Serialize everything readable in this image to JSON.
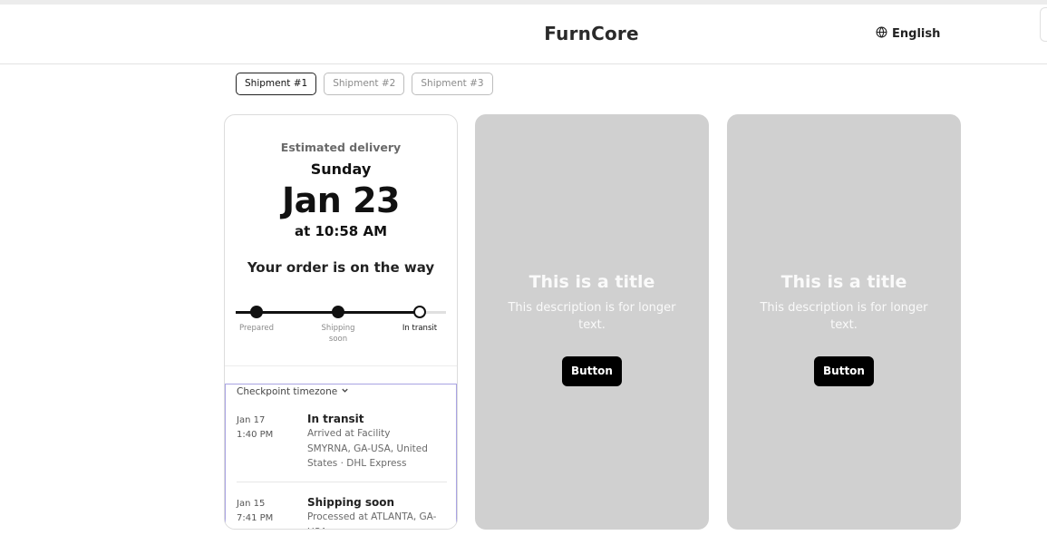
{
  "header": {
    "brand": "FurnCore",
    "language": "English",
    "globe_icon": "globe-icon"
  },
  "tabs": [
    {
      "label": "Shipment #1",
      "active": true
    },
    {
      "label": "Shipment #2",
      "active": false
    },
    {
      "label": "Shipment #3",
      "active": false
    }
  ],
  "delivery": {
    "label": "Estimated delivery",
    "day": "Sunday",
    "date": "Jan 23",
    "time": "at 10:58 AM",
    "status": "Your order is on the way"
  },
  "progress": {
    "steps": [
      {
        "label": "Prepared",
        "state": "done"
      },
      {
        "label": "Shipping soon",
        "state": "done"
      },
      {
        "label": "In transit",
        "state": "current"
      }
    ]
  },
  "checkpoints": {
    "timezone_label": "Checkpoint timezone",
    "chevron_icon": "chevron-down-icon",
    "items": [
      {
        "date": "Jan 17",
        "time": "1:40 PM",
        "title": "In transit",
        "desc": "Arrived at Facility",
        "location": "SMYRNA, GA-USA, United States · DHL Express"
      },
      {
        "date": "Jan 15",
        "time": "7:41 PM",
        "title": "Shipping soon",
        "desc": "Processed at ATLANTA, GA-USA"
      }
    ]
  },
  "placeholders": [
    {
      "title": "This is a title",
      "desc": "This description is for longer text.",
      "button": "Button"
    },
    {
      "title": "This is a title",
      "desc": "This description is for longer text.",
      "button": "Button"
    }
  ],
  "colors": {
    "placeholder_bg": "#d0d0d0",
    "accent": "#000000",
    "focus_outline": "#a9a3e3"
  }
}
